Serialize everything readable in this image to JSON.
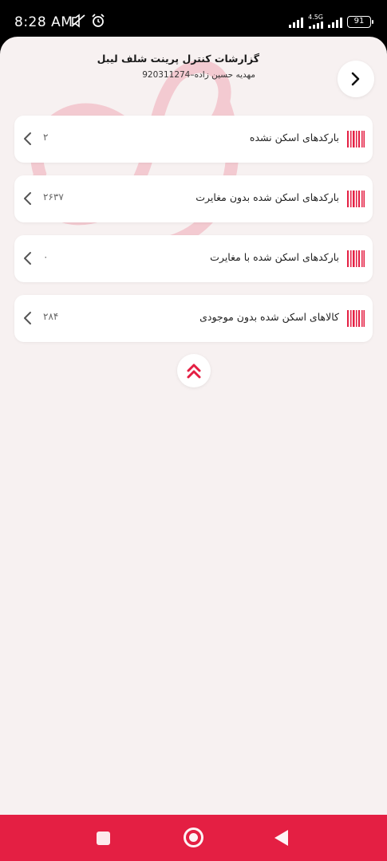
{
  "status_bar": {
    "time": "8:28 AM",
    "network": "4.5G",
    "battery": "91",
    "icons": [
      "mute-icon",
      "alarm-icon",
      "signal-icon",
      "signal-icon",
      "battery-icon"
    ]
  },
  "header": {
    "title": "گزارشات کنترل پرینت شلف لیبل",
    "subtitle": "مهدیه حسین زاده–920311274",
    "forward_icon": "chevron-right-icon"
  },
  "reports": [
    {
      "label": "بارکدهای اسکن نشده",
      "count": "۲"
    },
    {
      "label": "بارکدهای اسکن شده بدون مغایرت",
      "count": "۲۶۳۷"
    },
    {
      "label": "بارکدهای اسکن شده با مغایرت",
      "count": "۰"
    },
    {
      "label": "کالاهای اسکن شده بدون موجودی",
      "count": "۲۸۴"
    }
  ],
  "colors": {
    "accent": "#e41f43",
    "background": "#f7f1f1",
    "card": "#ffffff"
  }
}
